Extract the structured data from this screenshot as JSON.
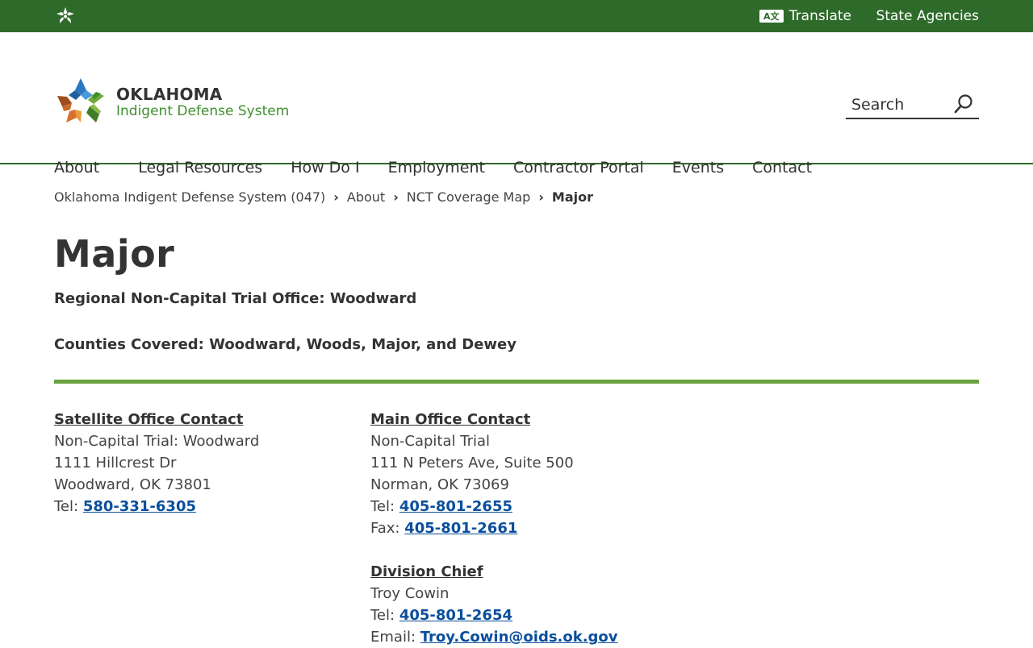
{
  "topbar": {
    "translate_label": "Translate",
    "state_agencies_label": "State Agencies"
  },
  "logo": {
    "line1": "OKLAHOMA",
    "line2": "Indigent Defense System"
  },
  "search": {
    "placeholder": "Search"
  },
  "nav": {
    "items": [
      "About",
      "Legal Resources",
      "How Do I",
      "Employment",
      "Contractor Portal",
      "Events",
      "Contact"
    ]
  },
  "breadcrumb": {
    "items": [
      "Oklahoma Indigent Defense System (047)",
      "About",
      "NCT Coverage Map"
    ],
    "current": "Major"
  },
  "page": {
    "title": "Major",
    "regional": "Regional Non-Capital Trial Office: Woodward",
    "counties": "Counties Covered: Woodward, Woods, Major, and Dewey"
  },
  "satellite": {
    "heading": "Satellite Office Contact",
    "line1": "Non-Capital Trial: Woodward",
    "line2": "1111 Hillcrest Dr",
    "line3": "Woodward, OK 73801",
    "tel_label": "Tel:",
    "tel": "580-331-6305"
  },
  "main_office": {
    "heading": "Main Office Contact",
    "line1": "Non-Capital Trial",
    "line2": "111 N Peters Ave, Suite 500",
    "line3": "Norman, OK 73069",
    "tel_label": "Tel:",
    "tel": "405-801-2655",
    "fax_label": "Fax:",
    "fax": "405-801-2661"
  },
  "division_chief": {
    "heading": "Division Chief",
    "name": "Troy Cowin",
    "tel_label": "Tel:",
    "tel": "405-801-2654",
    "email_label": "Email:",
    "email": "Troy.Cowin@oids.ok.gov"
  },
  "colors": {
    "topbar": "#2e6b2a",
    "rule": "#69a13e",
    "link": "#0b4f9c"
  }
}
